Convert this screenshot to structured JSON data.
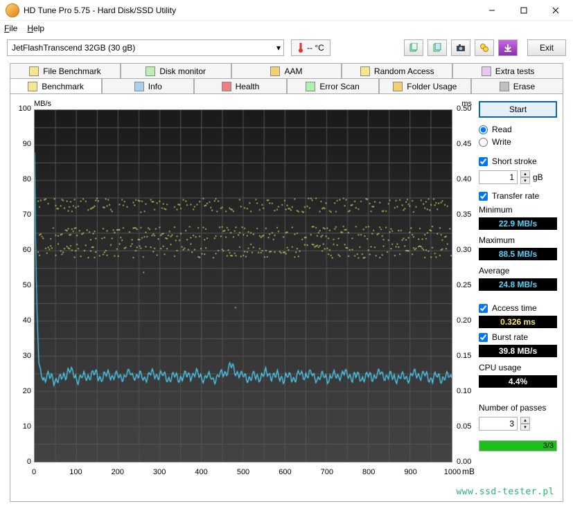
{
  "window": {
    "title": "HD Tune Pro 5.75 - Hard Disk/SSD Utility"
  },
  "menu": {
    "file": "File",
    "help": "Help"
  },
  "toolbar": {
    "device": "JetFlashTranscend 32GB (30 gB)",
    "temp": "-- °C",
    "exit": "Exit"
  },
  "tabs_row1": [
    {
      "label": "File Benchmark"
    },
    {
      "label": "Disk monitor"
    },
    {
      "label": "AAM"
    },
    {
      "label": "Random Access"
    },
    {
      "label": "Extra tests"
    }
  ],
  "tabs_row2": [
    {
      "label": "Benchmark",
      "active": true
    },
    {
      "label": "Info"
    },
    {
      "label": "Health"
    },
    {
      "label": "Error Scan"
    },
    {
      "label": "Folder Usage"
    },
    {
      "label": "Erase"
    }
  ],
  "sidebar": {
    "start": "Start",
    "read": "Read",
    "write": "Write",
    "short_stroke": "Short stroke",
    "short_stroke_value": "1",
    "short_stroke_unit": "gB",
    "transfer_rate": "Transfer rate",
    "min_label": "Minimum",
    "min_value": "22.9 MB/s",
    "max_label": "Maximum",
    "max_value": "88.5 MB/s",
    "avg_label": "Average",
    "avg_value": "24.8 MB/s",
    "access_time": "Access time",
    "access_value": "0.326 ms",
    "burst_rate": "Burst rate",
    "burst_value": "39.8 MB/s",
    "cpu_label": "CPU usage",
    "cpu_value": "4.4%",
    "passes_label": "Number of passes",
    "passes_value": "3",
    "progress_text": "3/3"
  },
  "watermark": "www.ssd-tester.pl",
  "chart_data": {
    "type": "line+scatter",
    "title": "",
    "xlabel": "mB",
    "ylabel_left": "MB/s",
    "ylabel_right": "ms",
    "xlim": [
      0,
      1000
    ],
    "ylim_left": [
      0,
      100
    ],
    "ylim_right": [
      0,
      0.5
    ],
    "x_ticks": [
      0,
      100,
      200,
      300,
      400,
      500,
      600,
      700,
      800,
      900,
      1000
    ],
    "y_ticks_left": [
      0,
      10,
      20,
      30,
      40,
      50,
      60,
      70,
      80,
      90,
      100
    ],
    "y_ticks_right": [
      0,
      0.05,
      0.1,
      0.15,
      0.2,
      0.25,
      0.3,
      0.35,
      0.4,
      0.45,
      0.5
    ],
    "series": [
      {
        "name": "Transfer rate",
        "axis": "left",
        "color": "#4fd6ff",
        "kind": "line",
        "x": [
          0,
          2,
          5,
          10,
          20,
          40,
          60,
          80,
          100,
          120,
          140,
          160,
          180,
          200,
          230,
          260,
          290,
          320,
          350,
          380,
          410,
          440,
          470,
          500,
          530,
          560,
          590,
          620,
          650,
          680,
          710,
          740,
          770,
          800,
          830,
          860,
          890,
          920,
          950,
          980,
          1000
        ],
        "y": [
          88,
          65,
          45,
          28,
          24,
          24,
          23,
          26,
          24,
          24,
          25,
          24,
          25,
          24,
          25,
          24,
          25,
          24,
          24,
          25,
          24,
          24,
          27,
          24,
          24,
          25,
          24,
          24,
          25,
          24,
          24,
          25,
          24,
          24,
          25,
          24,
          24,
          25,
          24,
          24,
          24
        ]
      },
      {
        "name": "Access time",
        "axis": "right",
        "color": "#f2e96b",
        "kind": "scatter",
        "bands": [
          {
            "center": 0.365,
            "jitter": 0.01
          },
          {
            "center": 0.325,
            "jitter": 0.01
          },
          {
            "center": 0.3,
            "jitter": 0.01
          }
        ],
        "x_range": [
          0,
          1000
        ]
      }
    ]
  }
}
